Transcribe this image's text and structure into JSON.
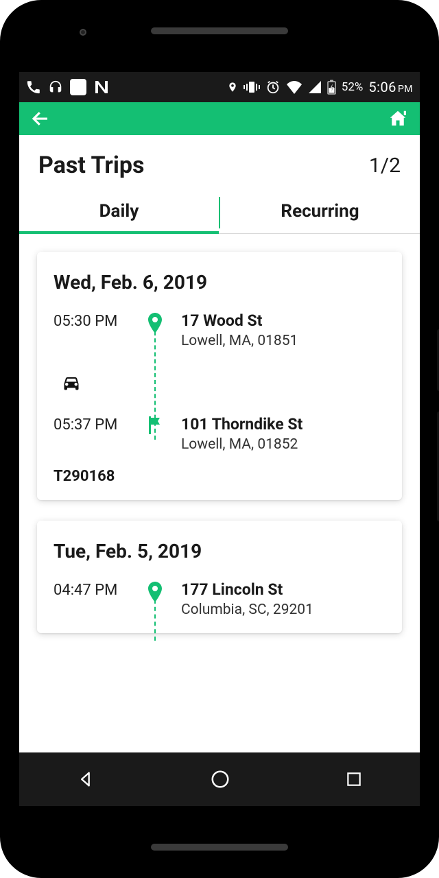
{
  "statusbar": {
    "battery_pct": "52%",
    "time": "5:06",
    "time_suffix": "PM"
  },
  "header": {
    "title": "Past Trips",
    "pager": "1/2"
  },
  "tabs": {
    "daily": "Daily",
    "recurring": "Recurring",
    "active": "daily"
  },
  "trips": [
    {
      "date": "Wed, Feb. 6, 2019",
      "start": {
        "time": "05:30 PM",
        "address": "17 Wood St",
        "city": "Lowell, MA, 01851"
      },
      "end": {
        "time": "05:37 PM",
        "address": "101 Thorndike St",
        "city": "Lowell, MA, 01852"
      },
      "mode": "car",
      "id": "T290168"
    },
    {
      "date": "Tue, Feb. 5, 2019",
      "start": {
        "time": "04:47 PM",
        "address": "177 Lincoln St",
        "city": "Columbia, SC, 29201"
      }
    }
  ]
}
